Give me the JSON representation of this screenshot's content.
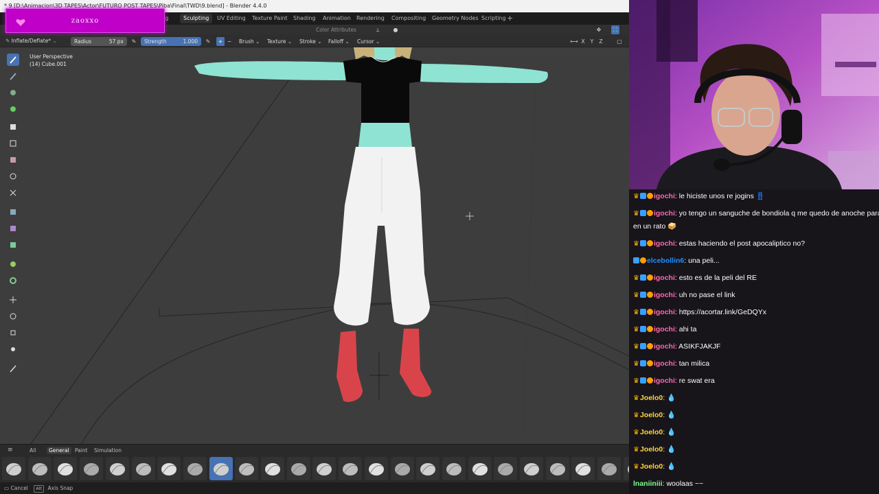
{
  "window": {
    "title": "* 9 [D:\\Animacion\\3D TAPES\\Actor\\FUTURO POST TAPES\\Piba\\Final\\TWD\\9.blend] - Blender 4.4.0"
  },
  "overlay": {
    "username": "zaoxxo"
  },
  "workspace_tabs": [
    {
      "label": "ing",
      "active": false
    },
    {
      "label": "Sculpting",
      "active": true
    },
    {
      "label": "UV Editing",
      "active": false
    },
    {
      "label": "Texture Paint",
      "active": false
    },
    {
      "label": "Shading",
      "active": false
    },
    {
      "label": "Animation",
      "active": false
    },
    {
      "label": "Rendering",
      "active": false
    },
    {
      "label": "Compositing",
      "active": false
    },
    {
      "label": "Geometry Nodes",
      "active": false
    },
    {
      "label": "Scripting",
      "active": false
    }
  ],
  "header2": {
    "color_attributes": "Color Attributes"
  },
  "tool_header": {
    "brush_name": "Inflate/Deflate*",
    "radius_label": "Radius",
    "radius_value": "57 px",
    "strength_label": "Strength",
    "strength_value": "1.000",
    "brush_menu": "Brush",
    "texture_menu": "Texture",
    "stroke_menu": "Stroke",
    "falloff_menu": "Falloff",
    "cursor_menu": "Cursor",
    "axis_x": "X",
    "axis_y": "Y",
    "axis_z": "Z"
  },
  "viewport": {
    "perspective": "User Perspective",
    "object": "(14) Cube.001"
  },
  "brush_panel": {
    "tabs": [
      {
        "label": "All",
        "active": false
      },
      {
        "label": "General",
        "active": true
      },
      {
        "label": "Paint",
        "active": false
      },
      {
        "label": "Simulation",
        "active": false
      }
    ],
    "active_index": 8,
    "count": 25
  },
  "status_bar": {
    "cancel": "Cancel",
    "alt_key": "Alt",
    "axis_snap": "Axis Snap"
  },
  "chat": [
    {
      "badges": "crown-sub",
      "name": "igochi",
      "name_color": "#ff69b4",
      "text": "le hiciste unos re jogins 👖",
      "lines": 1
    },
    {
      "badges": "crown-sub",
      "name": "igochi",
      "name_color": "#ff69b4",
      "text": "yo tengo un sanguche de bondiola q me quedo de anoche para cenar",
      "text2": "en un rato 🥪",
      "lines": 2
    },
    {
      "badges": "crown-sub",
      "name": "igochi",
      "name_color": "#ff69b4",
      "text": "estas haciendo el post apocaliptico no?",
      "lines": 1
    },
    {
      "badges": "sub",
      "name": "elcebollin6",
      "name_color": "#1e90ff",
      "text": "una peli...",
      "lines": 1
    },
    {
      "badges": "crown-sub",
      "name": "igochi",
      "name_color": "#ff69b4",
      "text": "esto es de la peli del RE",
      "lines": 1
    },
    {
      "badges": "crown-sub",
      "name": "igochi",
      "name_color": "#ff69b4",
      "text": "uh no pase el link",
      "lines": 1
    },
    {
      "badges": "crown-sub",
      "name": "igochi",
      "name_color": "#ff69b4",
      "text": "https://acortar.link/GeDQYx",
      "lines": 1
    },
    {
      "badges": "crown-sub",
      "name": "igochi",
      "name_color": "#ff69b4",
      "text": "ahi ta",
      "lines": 1
    },
    {
      "badges": "crown-sub",
      "name": "igochi",
      "name_color": "#ff69b4",
      "text": "ASIKFJAKJF",
      "lines": 1
    },
    {
      "badges": "crown-sub",
      "name": "igochi",
      "name_color": "#ff69b4",
      "text": "tan milica",
      "lines": 1
    },
    {
      "badges": "crown-sub",
      "name": "igochi",
      "name_color": "#ff69b4",
      "text": "re swat era",
      "lines": 1
    },
    {
      "badges": "crown",
      "name": "Joelo0",
      "name_color": "#ffd83a",
      "text": "💧",
      "lines": 1
    },
    {
      "badges": "crown",
      "name": "Joelo0",
      "name_color": "#ffd83a",
      "text": "💧",
      "lines": 1
    },
    {
      "badges": "crown",
      "name": "Joelo0",
      "name_color": "#ffd83a",
      "text": "💧",
      "lines": 1
    },
    {
      "badges": "crown",
      "name": "Joelo0",
      "name_color": "#ffd83a",
      "text": "💧",
      "lines": 1
    },
    {
      "badges": "crown",
      "name": "Joelo0",
      "name_color": "#ffd83a",
      "text": "💧",
      "lines": 1
    },
    {
      "badges": "",
      "name": "lnaniiniii",
      "name_color": "#7dff8a",
      "text": "woolaas ~~",
      "lines": 1
    }
  ],
  "colors": {
    "blender_accent": "#4772b3",
    "overlay_magenta": "#c000c8",
    "skin_mint": "#8fe3d2",
    "shirt": "#0a0a0a",
    "pants": "#f2f2f2",
    "boots": "#d9444a",
    "chat_bg": "#17141a"
  }
}
